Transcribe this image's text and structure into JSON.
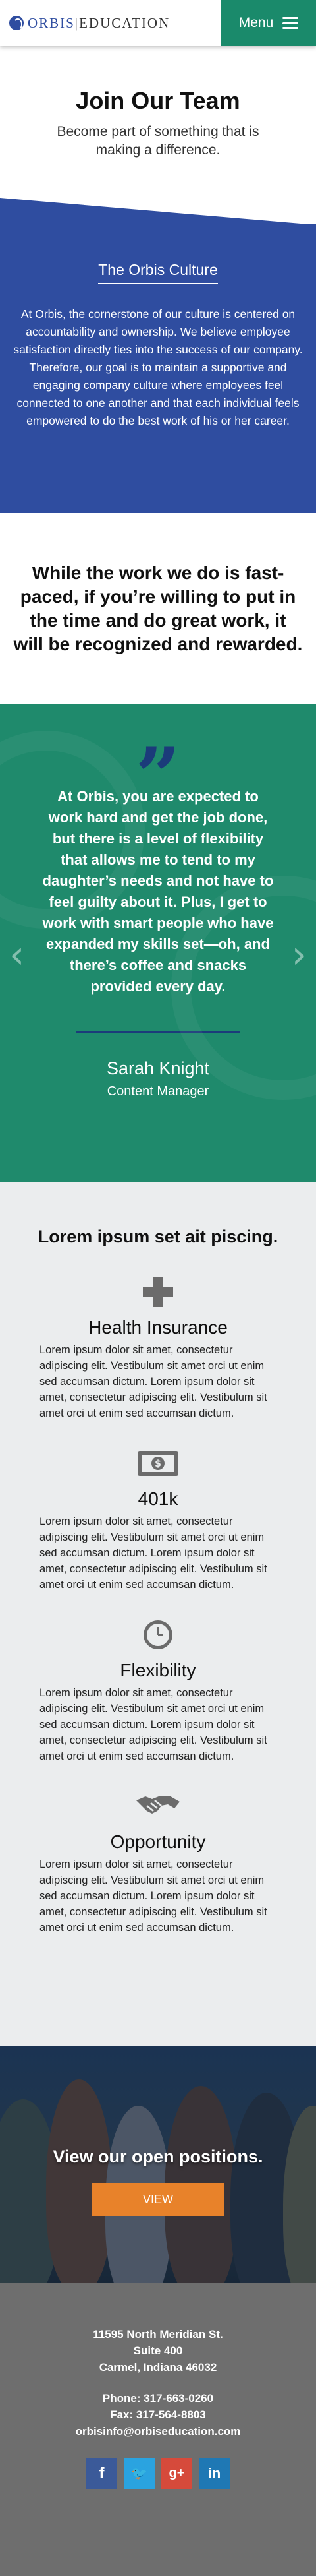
{
  "header": {
    "logo_left": "ORBIS",
    "logo_right": "EDUCATION",
    "menu_label": "Menu"
  },
  "join": {
    "title": "Join Our Team",
    "subtitle": "Become part of something that is making a difference."
  },
  "culture": {
    "title": "The Orbis Culture",
    "body": "At Orbis, the cornerstone of our culture is centered on accountability and ownership. We believe employee satisfaction directly ties into the success of our company. Therefore, our goal is to maintain a supportive and engaging company culture where employees feel connected to one another and that each individual feels empowered to do the best work of his or her career."
  },
  "statement": "While the work we do is fast-paced, if you’re willing to put in the time and do great work, it will be recognized and rewarded.",
  "testimonial": {
    "quote": "At Orbis, you are expected to work hard and get the job done, but there is a level of flexibility that allows me to tend to my daughter’s needs and not have to feel guilty about it. Plus, I get to work with smart people who have expanded my skills set—oh, and there’s coffee and snacks provided every day.",
    "name": "Sarah Knight",
    "role": "Content Manager"
  },
  "benefits": {
    "title": "Lorem ipsum set ait piscing.",
    "items": [
      {
        "name": "Health Insurance",
        "icon": "plus-icon",
        "text": "Lorem ipsum dolor sit amet, consectetur adipiscing elit. Vestibulum sit amet orci ut enim sed accumsan dictum.  Lorem ipsum dolor sit amet, consectetur adipiscing elit. Vestibulum sit amet orci ut enim sed accumsan dictum."
      },
      {
        "name": "401k",
        "icon": "money-icon",
        "text": "Lorem ipsum dolor sit amet, consectetur adipiscing elit. Vestibulum sit amet orci ut enim sed accumsan dictum.  Lorem ipsum dolor sit amet, consectetur adipiscing elit. Vestibulum sit amet orci ut enim sed accumsan dictum."
      },
      {
        "name": "Flexibility",
        "icon": "clock-icon",
        "text": "Lorem ipsum dolor sit amet, consectetur adipiscing elit. Vestibulum sit amet orci ut enim sed accumsan dictum.  Lorem ipsum dolor sit amet, consectetur adipiscing elit. Vestibulum sit amet orci ut enim sed accumsan dictum."
      },
      {
        "name": "Opportunity",
        "icon": "handshake-icon",
        "text": "Lorem ipsum dolor sit amet, consectetur adipiscing elit. Vestibulum sit amet orci ut enim sed accumsan dictum.  Lorem ipsum dolor sit amet, consectetur adipiscing elit. Vestibulum sit amet orci ut enim sed accumsan dictum."
      }
    ]
  },
  "positions": {
    "title": "View our open positions.",
    "button": "VIEW"
  },
  "footer": {
    "address_line1": "11595 North Meridian St.",
    "address_line2": "Suite 400",
    "address_line3": "Carmel, Indiana 46032",
    "phone": "Phone: 317-663-0260",
    "fax": "Fax: 317-564-8803",
    "email": "orbisinfo@orbiseducation.com",
    "social": {
      "facebook": "f",
      "twitter": "🐦",
      "google": "g+",
      "linkedin": "in"
    }
  },
  "colors": {
    "brand_blue": "#2f4da0",
    "brand_green": "#1a8a6b",
    "cta_orange": "#e8822a",
    "footer_gray": "#6e6e6e"
  }
}
